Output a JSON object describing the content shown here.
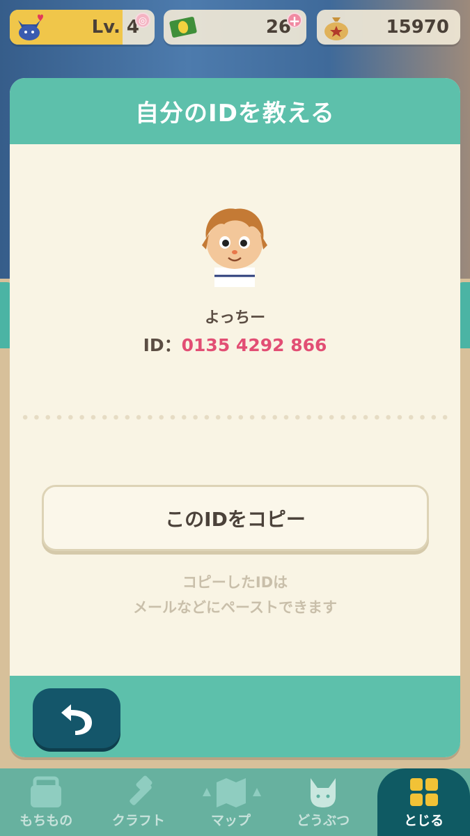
{
  "status_bar": {
    "level_label": "Lv. 4",
    "level_progress": 0.78,
    "tickets": "26",
    "bells": "15970"
  },
  "dialog": {
    "title": "自分のIDを教える",
    "player_name": "よっちー",
    "id_label": "ID：",
    "id_value": "0135 4292 866",
    "copy_button_label": "このIDをコピー",
    "note_line1": "コピーしたIDは",
    "note_line2": "メールなどにペーストできます"
  },
  "nav": {
    "items": [
      {
        "label": "もちもの",
        "icon": "bag-icon"
      },
      {
        "label": "クラフト",
        "icon": "hammer-icon"
      },
      {
        "label": "マップ",
        "icon": "map-icon"
      },
      {
        "label": "どうぶつ",
        "icon": "cat-icon"
      },
      {
        "label": "とじる",
        "icon": "grid-icon"
      }
    ],
    "active_index": 4
  },
  "colors": {
    "teal": "#5dc0ab",
    "id_pink": "#e24e74",
    "back_button": "#14566a"
  }
}
